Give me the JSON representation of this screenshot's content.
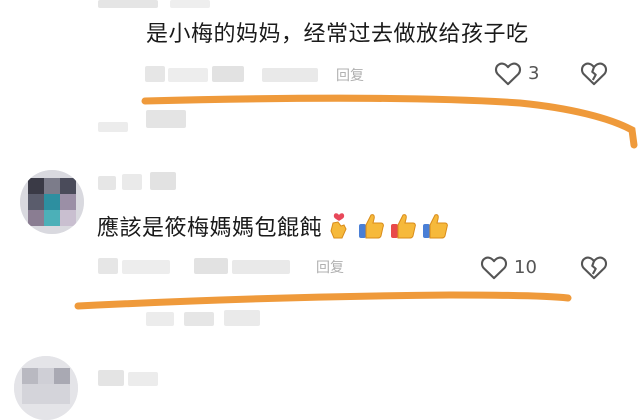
{
  "comments": [
    {
      "text": "是小梅的妈妈，经常过去做放给孩子吃",
      "reply_label": "回复",
      "likes": "3"
    },
    {
      "text": "應該是筱梅媽媽包餛飩",
      "reply_label": "回复",
      "likes": "10",
      "reactions": [
        "love-you-hand-emoji",
        "thumbs-up-emoji",
        "thumbs-up-emoji",
        "thumbs-up-emoji"
      ]
    }
  ],
  "colors": {
    "accent_stroke": "#ef9a3b",
    "text": "#1a1a1a",
    "meta": "#b0b0b0",
    "icon": "#555555"
  }
}
